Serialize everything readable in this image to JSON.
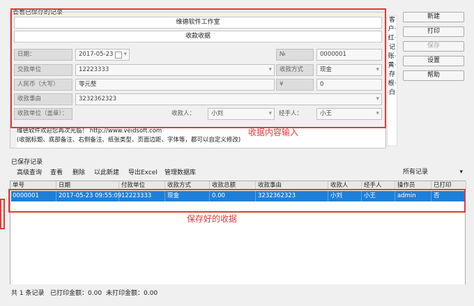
{
  "group_title": "查看已保存的记录",
  "receipt": {
    "company": "维德软件工作室",
    "title": "收款收据",
    "date_label": "日期：",
    "date_value": "2017-05-23",
    "no_label": "№",
    "no_value": "0000001",
    "payer_label": "交款单位",
    "payer_value": "12223333",
    "method_label": "收款方式",
    "method_value": "现金",
    "rmb_label": "人民币（大写）",
    "rmb_value": "零元整",
    "yen_symbol": "¥",
    "amount_value": "0",
    "reason_label": "收款事由",
    "reason_value": "3232362323",
    "unit_label": "收款单位（盖章）：",
    "receiver_label": "收款人：",
    "receiver_value": "小刘",
    "handler_label": "经手人：",
    "handler_value": "小王"
  },
  "note": {
    "line1": "维德软件欢迎您再次光临！ http://www.veidsoft.com",
    "line2": "(收据标题、底部备注、右侧备注、纸张类型、页面边距、字体等，都可以自定义修改)"
  },
  "side_text": "客户·红·记账·黄·存根·白",
  "buttons": {
    "new": "新建",
    "print": "打印",
    "save": "保存",
    "settings": "设置",
    "help": "帮助"
  },
  "annotations": {
    "input_hint": "收据内容输入",
    "saved_hint": "保存好的收据"
  },
  "saved": {
    "title": "已保存记录",
    "toolbar": {
      "advanced": "高级查询",
      "view": "查看",
      "delete": "删除",
      "copy_new": "以此新建",
      "export": "导出Excel",
      "manage_db": "管理数据库"
    },
    "filter": "所有记录",
    "columns": [
      "单号",
      "日期",
      "付款单位",
      "收款方式",
      "收款总额",
      "收款事由",
      "收款人",
      "经手人",
      "操作员",
      "已打印"
    ],
    "row": [
      "0000001",
      "2017-05-23 09:55:09",
      "12223333",
      "现金",
      "0.00",
      "3232362323",
      "小刘",
      "小王",
      "admin",
      "否"
    ]
  },
  "status": {
    "count": "共 1 条记录",
    "printed": "已打印金额：0.00",
    "unprinted": "未打印金额：0.00"
  }
}
